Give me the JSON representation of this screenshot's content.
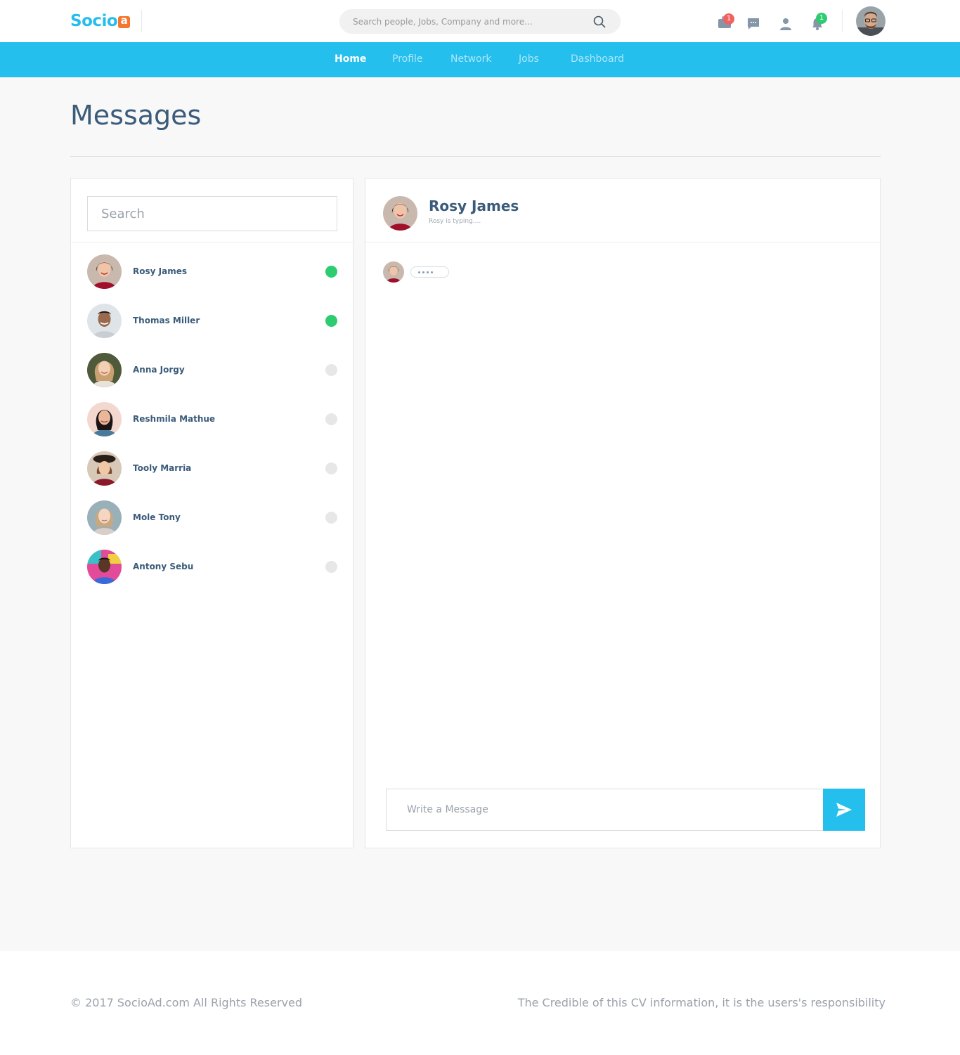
{
  "brand": {
    "logo_text": "Socio",
    "logo_mark": "ad-badge-icon"
  },
  "header": {
    "search_placeholder": "Search people, Jobs, Company and more...",
    "icons": [
      {
        "name": "briefcase-icon",
        "badge": "1",
        "badge_color": "#f0625f"
      },
      {
        "name": "chat-icon",
        "badge": ""
      },
      {
        "name": "user-icon",
        "badge": ""
      },
      {
        "name": "bell-icon",
        "badge": "1",
        "badge_color": "#2ecc71"
      }
    ]
  },
  "nav": {
    "items": [
      {
        "label": "Home",
        "active": true
      },
      {
        "label": "Profile",
        "active": false
      },
      {
        "label": "Network",
        "active": false
      },
      {
        "label": "Jobs",
        "active": false
      },
      {
        "label": "Dashboard",
        "active": false
      }
    ]
  },
  "page": {
    "title": "Messages"
  },
  "contacts": {
    "search_placeholder": "Search",
    "items": [
      {
        "name": "Rosy James",
        "online": true
      },
      {
        "name": "Thomas Miller",
        "online": true
      },
      {
        "name": "Anna Jorgy",
        "online": false
      },
      {
        "name": "Reshmila Mathue",
        "online": false
      },
      {
        "name": "Tooly Marria",
        "online": false
      },
      {
        "name": "Mole Tony",
        "online": false
      },
      {
        "name": "Antony Sebu",
        "online": false
      }
    ]
  },
  "chat": {
    "name": "Rosy James",
    "status": "Rosy is typing....",
    "composer_placeholder": "Write a Message",
    "send_icon": "send-icon"
  },
  "footer": {
    "copyright": "© 2017 SocioAd.com All Rights Reserved",
    "disclaimer": "The Credible of this CV information, it is the users's responsibility"
  },
  "colors": {
    "accent": "#24bfed",
    "heading": "#3b5b7a",
    "online": "#2ecc71",
    "offline": "#e7e7e7",
    "badge_red": "#f0625f"
  }
}
